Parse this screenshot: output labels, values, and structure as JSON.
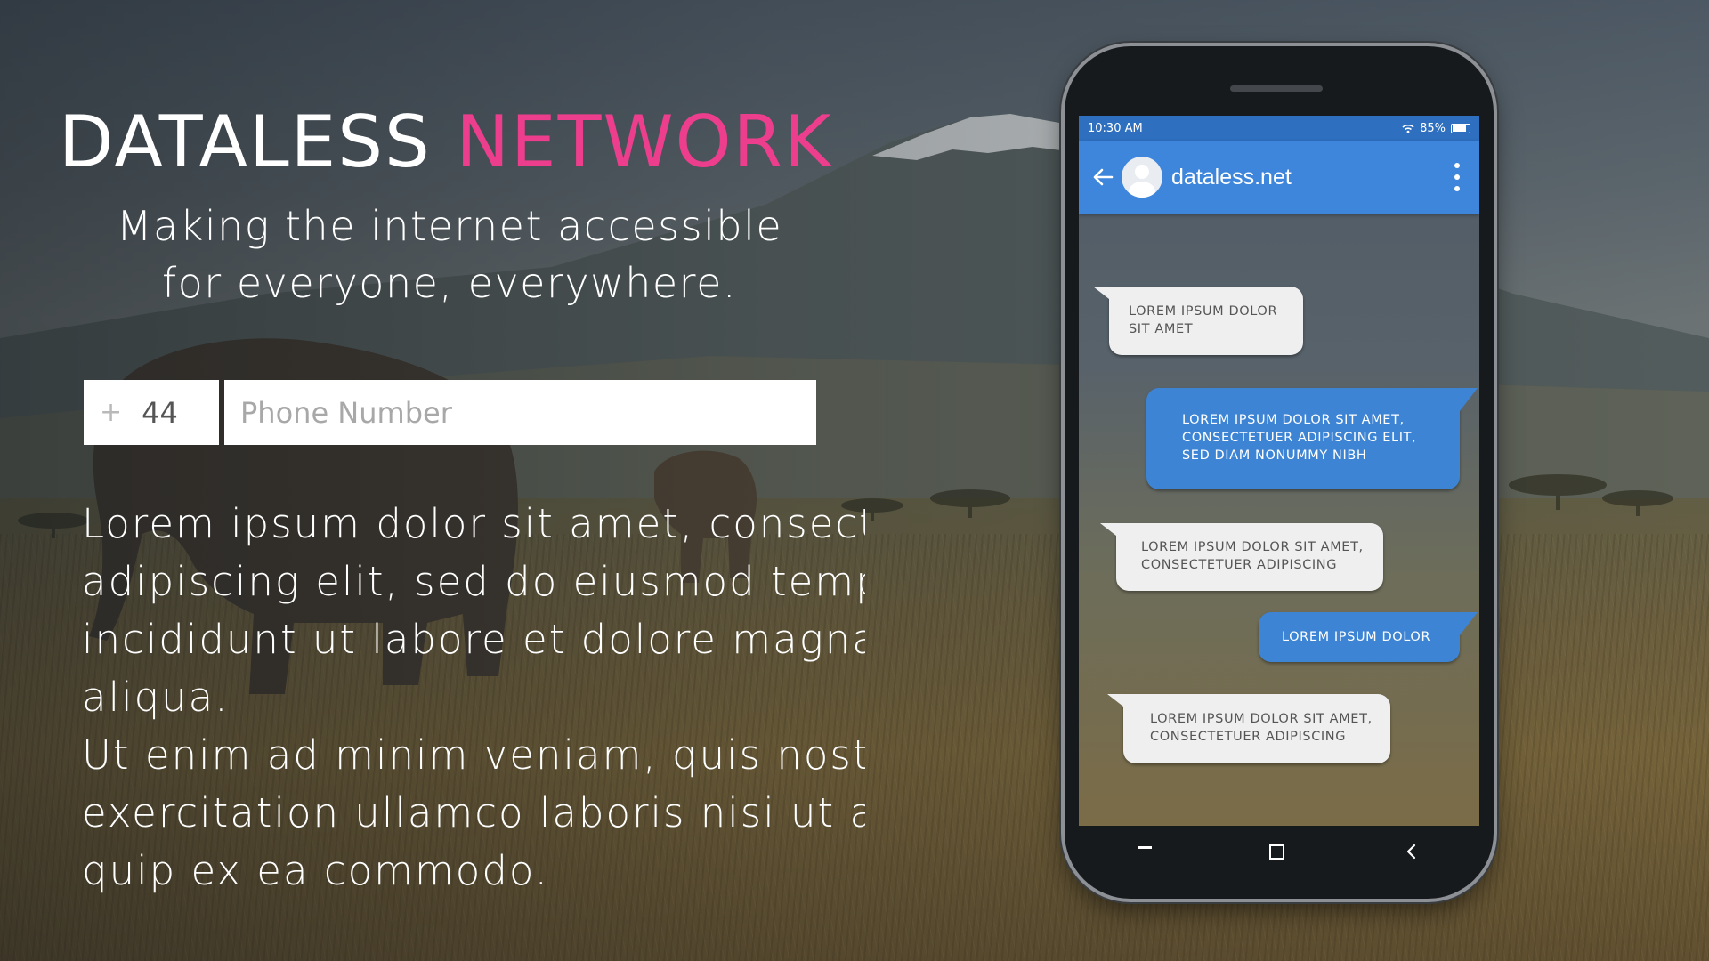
{
  "header": {
    "title_part1": "DATALESS ",
    "title_part2": "NETWORK",
    "tagline_line1": "Making the internet accessible",
    "tagline_line2": "for everyone, everywhere."
  },
  "phone_form": {
    "plus_symbol": "+",
    "country_code": "44",
    "phone_placeholder": "Phone Number",
    "phone_value": ""
  },
  "body": {
    "lines": [
      "Lorem ipsum dolor sit amet, consect",
      "adipiscing elit, sed do eiusmod temp",
      "incididunt ut labore et dolore magna",
      "aliqua.",
      "Ut enim ad minim veniam, quis nostr",
      "exercitation ullamco laboris nisi ut ali",
      "quip ex ea commodo."
    ]
  },
  "device": {
    "status_time": "10:30 AM",
    "battery": "85%",
    "contact_name": "dataless.net",
    "messages": [
      {
        "direction": "in",
        "lines": [
          "LOREM IPSUM DOLOR",
          "SIT AMET"
        ]
      },
      {
        "direction": "out",
        "lines": [
          "LOREM IPSUM DOLOR SIT AMET,",
          "CONSECTETUER ADIPISCING ELIT,",
          "SED DIAM NONUMMY NIBH"
        ]
      },
      {
        "direction": "in",
        "lines": [
          "LOREM IPSUM DOLOR SIT AMET,",
          "CONSECTETUER ADIPISCING"
        ]
      },
      {
        "direction": "out",
        "lines": [
          "LOREM IPSUM DOLOR"
        ]
      },
      {
        "direction": "in",
        "lines": [
          "LOREM IPSUM DOLOR SIT AMET,",
          "CONSECTETUER ADIPISCING"
        ]
      }
    ]
  },
  "colors": {
    "accent_pink": "#ec3e8c",
    "app_bar_blue": "#3e86db",
    "status_bar_blue": "#2e6fbf",
    "outgoing_bubble": "#3d84d4",
    "incoming_bubble": "#efefef"
  },
  "icons": {
    "back": "arrow-left-icon",
    "menu": "more-vertical-icon",
    "wifi": "wifi-icon",
    "battery": "battery-icon",
    "avatar": "user-avatar-icon",
    "nav_recent": "recent-apps-icon",
    "nav_home": "home-square-icon",
    "nav_back": "chevron-left-icon"
  }
}
